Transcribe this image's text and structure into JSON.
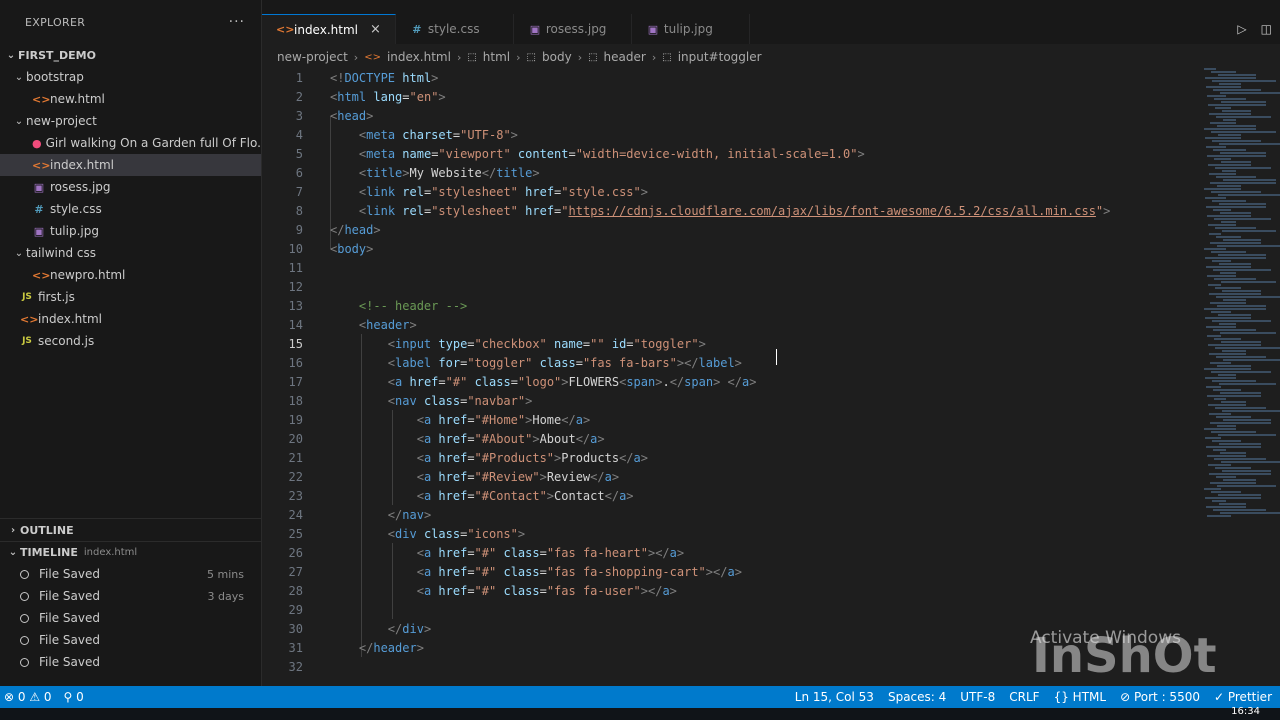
{
  "explorer": {
    "title": "EXPLORER",
    "more": "···",
    "workspace": "FIRST_DEMO",
    "tree": [
      {
        "label": "bootstrap",
        "type": "folder",
        "depth": 1,
        "open": true
      },
      {
        "label": "new.html",
        "type": "html",
        "depth": 2
      },
      {
        "label": "new-project",
        "type": "folder",
        "depth": 1,
        "open": true
      },
      {
        "label": "Girl walking On a Garden full Of Flo...",
        "type": "video",
        "depth": 2
      },
      {
        "label": "index.html",
        "type": "html",
        "depth": 2,
        "active": true
      },
      {
        "label": "rosess.jpg",
        "type": "img",
        "depth": 2
      },
      {
        "label": "style.css",
        "type": "css",
        "depth": 2
      },
      {
        "label": "tulip.jpg",
        "type": "img",
        "depth": 2
      },
      {
        "label": "tailwind css",
        "type": "folder",
        "depth": 1,
        "open": true
      },
      {
        "label": "newpro.html",
        "type": "html",
        "depth": 2
      },
      {
        "label": "first.js",
        "type": "js",
        "depth": 1
      },
      {
        "label": "index.html",
        "type": "html",
        "depth": 1
      },
      {
        "label": "second.js",
        "type": "js",
        "depth": 1
      }
    ]
  },
  "outline": {
    "title": "OUTLINE"
  },
  "timeline": {
    "title": "TIMELINE",
    "file": "index.html",
    "items": [
      {
        "label": "File Saved",
        "ago": "5 mins"
      },
      {
        "label": "File Saved",
        "ago": "3 days"
      },
      {
        "label": "File Saved",
        "ago": ""
      },
      {
        "label": "File Saved",
        "ago": ""
      },
      {
        "label": "File Saved",
        "ago": ""
      }
    ]
  },
  "tabs": [
    {
      "label": "index.html",
      "type": "html",
      "active": true,
      "close": "×"
    },
    {
      "label": "style.css",
      "type": "css"
    },
    {
      "label": "rosess.jpg",
      "type": "img"
    },
    {
      "label": "tulip.jpg",
      "type": "img"
    }
  ],
  "breadcrumb": [
    "new-project",
    "index.html",
    "html",
    "body",
    "header",
    "input#toggler"
  ],
  "editor": {
    "current_line": 15,
    "lines": [
      {
        "n": "1",
        "html": "<span class='t'>&lt;!</span><span class='tg'>DOCTYPE</span> <span class='at'>html</span><span class='t'>&gt;</span>"
      },
      {
        "n": "2",
        "html": "<span class='t'>&lt;</span><span class='tg'>html</span> <span class='at'>lang</span>=<span class='st'>\"en\"</span><span class='t'>&gt;</span>"
      },
      {
        "n": "3",
        "html": "<span class='t'>&lt;</span><span class='tg'>head</span><span class='t'>&gt;</span>"
      },
      {
        "n": "4",
        "html": "    <span class='t'>&lt;</span><span class='tg'>meta</span> <span class='at'>charset</span>=<span class='st'>\"UTF-8\"</span><span class='t'>&gt;</span>"
      },
      {
        "n": "5",
        "html": "    <span class='t'>&lt;</span><span class='tg'>meta</span> <span class='at'>name</span>=<span class='st'>\"viewport\"</span> <span class='at'>content</span>=<span class='st'>\"width=device-width, initial-scale=1.0\"</span><span class='t'>&gt;</span>"
      },
      {
        "n": "6",
        "html": "    <span class='t'>&lt;</span><span class='tg'>title</span><span class='t'>&gt;</span><span class='tx'>My Website</span><span class='t'>&lt;/</span><span class='tg'>title</span><span class='t'>&gt;</span>"
      },
      {
        "n": "7",
        "html": "    <span class='t'>&lt;</span><span class='tg'>link</span> <span class='at'>rel</span>=<span class='st'>\"stylesheet\"</span> <span class='at'>href</span>=<span class='st'>\"style.css\"</span><span class='t'>&gt;</span>"
      },
      {
        "n": "8",
        "html": "    <span class='t'>&lt;</span><span class='tg'>link</span> <span class='at'>rel</span>=<span class='st'>\"stylesheet\"</span> <span class='at'>href</span>=<span class='st'>\"</span><span class='url'>https://cdnjs.cloudflare.com/ajax/libs/font-awesome/6.5.2/css/all.min.css</span><span class='st'>\"</span><span class='t'>&gt;</span>"
      },
      {
        "n": "9",
        "html": "<span class='t'>&lt;/</span><span class='tg'>head</span><span class='t'>&gt;</span>"
      },
      {
        "n": "10",
        "html": "<span class='t'>&lt;</span><span class='tg'>body</span><span class='t'>&gt;</span>"
      },
      {
        "n": "11",
        "html": ""
      },
      {
        "n": "12",
        "html": ""
      },
      {
        "n": "13",
        "html": "    <span class='cm'>&lt;!-- header --&gt;</span>"
      },
      {
        "n": "14",
        "html": "    <span class='t'>&lt;</span><span class='tg'>header</span><span class='t'>&gt;</span>"
      },
      {
        "n": "15",
        "html": "        <span class='t'>&lt;</span><span class='tg'>input</span> <span class='at'>type</span>=<span class='st'>\"checkbox\"</span> <span class='at'>name</span>=<span class='st'>\"\"</span> <span class='at'>id</span>=<span class='st'>\"toggler\"</span><span class='t'>&gt;</span>"
      },
      {
        "n": "16",
        "html": "        <span class='t'>&lt;</span><span class='tg'>label</span> <span class='at'>for</span>=<span class='st'>\"toggler\"</span> <span class='at'>class</span>=<span class='st'>\"fas fa-bars\"</span><span class='t'>&gt;&lt;/</span><span class='tg'>label</span><span class='t'>&gt;</span>"
      },
      {
        "n": "17",
        "html": "        <span class='t'>&lt;</span><span class='tg'>a</span> <span class='at'>href</span>=<span class='st'>\"#\"</span> <span class='at'>class</span>=<span class='st'>\"logo\"</span><span class='t'>&gt;</span><span class='tx'>FLOWERS</span><span class='t'>&lt;</span><span class='tg'>span</span><span class='t'>&gt;</span><span class='tx'>.</span><span class='t'>&lt;/</span><span class='tg'>span</span><span class='t'>&gt;</span> <span class='t'>&lt;/</span><span class='tg'>a</span><span class='t'>&gt;</span>"
      },
      {
        "n": "18",
        "html": "        <span class='t'>&lt;</span><span class='tg'>nav</span> <span class='at'>class</span>=<span class='st'>\"navbar\"</span><span class='t'>&gt;</span>"
      },
      {
        "n": "19",
        "html": "            <span class='t'>&lt;</span><span class='tg'>a</span> <span class='at'>href</span>=<span class='st'>\"#Home\"</span><span class='t'>&gt;</span><span class='tx'>Home</span><span class='t'>&lt;/</span><span class='tg'>a</span><span class='t'>&gt;</span>"
      },
      {
        "n": "20",
        "html": "            <span class='t'>&lt;</span><span class='tg'>a</span> <span class='at'>href</span>=<span class='st'>\"#About\"</span><span class='t'>&gt;</span><span class='tx'>About</span><span class='t'>&lt;/</span><span class='tg'>a</span><span class='t'>&gt;</span>"
      },
      {
        "n": "21",
        "html": "            <span class='t'>&lt;</span><span class='tg'>a</span> <span class='at'>href</span>=<span class='st'>\"#Products\"</span><span class='t'>&gt;</span><span class='tx'>Products</span><span class='t'>&lt;/</span><span class='tg'>a</span><span class='t'>&gt;</span>"
      },
      {
        "n": "22",
        "html": "            <span class='t'>&lt;</span><span class='tg'>a</span> <span class='at'>href</span>=<span class='st'>\"#Review\"</span><span class='t'>&gt;</span><span class='tx'>Review</span><span class='t'>&lt;/</span><span class='tg'>a</span><span class='t'>&gt;</span>"
      },
      {
        "n": "23",
        "html": "            <span class='t'>&lt;</span><span class='tg'>a</span> <span class='at'>href</span>=<span class='st'>\"#Contact\"</span><span class='t'>&gt;</span><span class='tx'>Contact</span><span class='t'>&lt;/</span><span class='tg'>a</span><span class='t'>&gt;</span>"
      },
      {
        "n": "24",
        "html": "        <span class='t'>&lt;/</span><span class='tg'>nav</span><span class='t'>&gt;</span>"
      },
      {
        "n": "25",
        "html": "        <span class='t'>&lt;</span><span class='tg'>div</span> <span class='at'>class</span>=<span class='st'>\"icons\"</span><span class='t'>&gt;</span>"
      },
      {
        "n": "26",
        "html": "            <span class='t'>&lt;</span><span class='tg'>a</span> <span class='at'>href</span>=<span class='st'>\"#\"</span> <span class='at'>class</span>=<span class='st'>\"fas fa-heart\"</span><span class='t'>&gt;&lt;/</span><span class='tg'>a</span><span class='t'>&gt;</span>"
      },
      {
        "n": "27",
        "html": "            <span class='t'>&lt;</span><span class='tg'>a</span> <span class='at'>href</span>=<span class='st'>\"#\"</span> <span class='at'>class</span>=<span class='st'>\"fas fa-shopping-cart\"</span><span class='t'>&gt;&lt;/</span><span class='tg'>a</span><span class='t'>&gt;</span>"
      },
      {
        "n": "28",
        "html": "            <span class='t'>&lt;</span><span class='tg'>a</span> <span class='at'>href</span>=<span class='st'>\"#\"</span> <span class='at'>class</span>=<span class='st'>\"fas fa-user\"</span><span class='t'>&gt;&lt;/</span><span class='tg'>a</span><span class='t'>&gt;</span>"
      },
      {
        "n": "29",
        "html": ""
      },
      {
        "n": "30",
        "html": "        <span class='t'>&lt;/</span><span class='tg'>div</span><span class='t'>&gt;</span>"
      },
      {
        "n": "31",
        "html": "    <span class='t'>&lt;/</span><span class='tg'>header</span><span class='t'>&gt;</span>"
      },
      {
        "n": "32",
        "html": ""
      }
    ]
  },
  "statusbar": {
    "problems": "⊗ 0 ⚠ 0",
    "ports": "0",
    "position": "Ln 15, Col 53",
    "spaces": "Spaces: 4",
    "encoding": "UTF-8",
    "eol": "CRLF",
    "language": "HTML",
    "live_server": "Port : 5500",
    "prettier": "Prettier"
  },
  "taskbar": {
    "clock": "16:34"
  },
  "watermark": {
    "activate": "Activate Windows",
    "brand": "InShOt"
  },
  "colors": {
    "accent": "#007acc",
    "tab_active_border": "#0078d4"
  }
}
